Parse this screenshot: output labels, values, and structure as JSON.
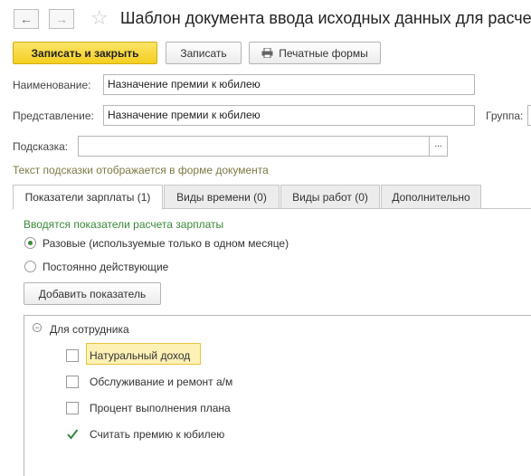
{
  "window": {
    "title": "Шаблон документа ввода исходных данных для расче"
  },
  "toolbar": {
    "save_close_label": "Записать и закрыть",
    "save_label": "Записать",
    "print_label": "Печатные формы"
  },
  "form": {
    "name_label": "Наименование:",
    "name_value": "Назначение премии к юбилею",
    "presentation_label": "Представление:",
    "presentation_value": "Назначение премии к юбилею",
    "group_label": "Группа:",
    "hint_label": "Подсказка:",
    "hint_value": "",
    "hint_button": "...",
    "hint_note": "Текст подсказки отображается в форме документа"
  },
  "tabs": [
    {
      "label": "Показатели зарплаты (1)",
      "active": true
    },
    {
      "label": "Виды времени (0)",
      "active": false
    },
    {
      "label": "Виды работ (0)",
      "active": false
    },
    {
      "label": "Дополнительно",
      "active": false
    }
  ],
  "indicators": {
    "caption": "Вводятся показатели расчета зарплаты",
    "radio_one_time": "Разовые (используемые только в одном месяце)",
    "radio_permanent": "Постоянно действующие",
    "selected_radio": "one_time",
    "add_button": "Добавить показатель"
  },
  "tree": {
    "group_label": "Для сотрудника",
    "items": [
      {
        "label": "Натуральный доход",
        "checked": false,
        "focused": true
      },
      {
        "label": "Обслуживание и ремонт а/м",
        "checked": false,
        "focused": false
      },
      {
        "label": "Процент выполнения плана",
        "checked": false,
        "focused": false
      },
      {
        "label": "Считать премию к юбилею",
        "checked": true,
        "focused": false
      }
    ]
  },
  "colors": {
    "accent_yellow": "#f4cf1f",
    "green": "#3a8a3a",
    "hint_text": "#7c7a44"
  }
}
